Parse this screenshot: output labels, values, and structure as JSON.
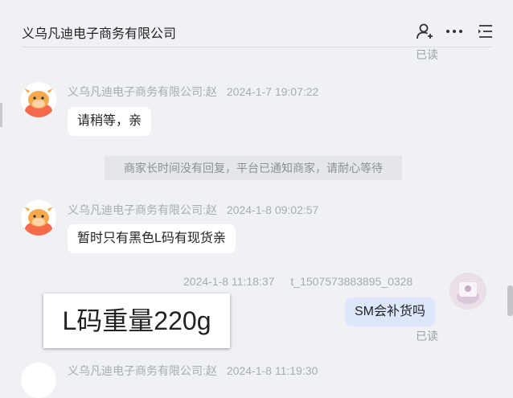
{
  "header": {
    "title": "义乌凡迪电子商务有限公司",
    "icons": [
      "person-add-icon",
      "more-icon",
      "menu-list-icon"
    ]
  },
  "read_status_top": "已读",
  "messages": [
    {
      "sender": "义乌凡迪电子商务有限公司:赵",
      "time": "2024-1-7 19:07:22",
      "text": "请稍等，亲"
    },
    {
      "sender": "义乌凡迪电子商务有限公司:赵",
      "time": "2024-1-8 09:02:57",
      "text": "暂时只有黑色L码有现货亲"
    }
  ],
  "system_notice": "商家长时间没有回复，平台已通知商家，请耐心等待",
  "user_message": {
    "time": "2024-1-8 11:18:37",
    "sender": "t_1507573883895_0328",
    "text": "SM会补货吗",
    "read_status": "已读"
  },
  "popup_card": {
    "text": "L码重量220g"
  },
  "partial_message": {
    "sender": "义乌凡迪电子商务有限公司:赵",
    "time": "2024-1-8 11:19:30"
  }
}
